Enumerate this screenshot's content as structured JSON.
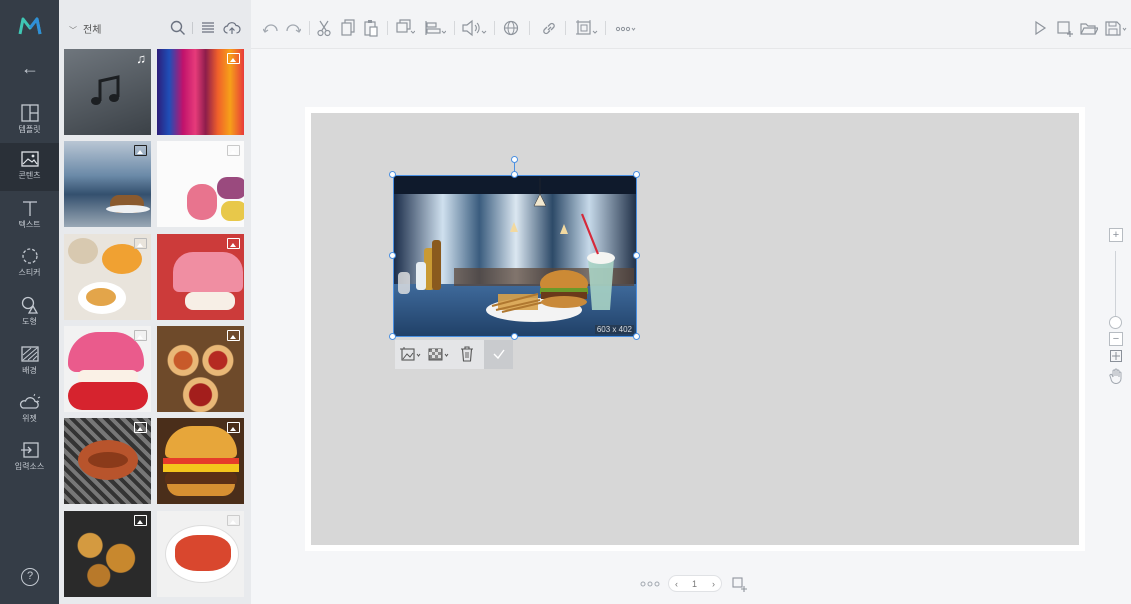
{
  "sidebar": {
    "items": [
      {
        "label": "템플릿",
        "icon": "template-icon"
      },
      {
        "label": "콘텐츠",
        "icon": "image-icon"
      },
      {
        "label": "텍스트",
        "icon": "text-icon"
      },
      {
        "label": "스티커",
        "icon": "sticker-icon"
      },
      {
        "label": "도형",
        "icon": "shape-icon"
      },
      {
        "label": "배경",
        "icon": "background-icon"
      },
      {
        "label": "위젯",
        "icon": "weather-widget-icon"
      },
      {
        "label": "입력소스",
        "icon": "input-source-icon"
      }
    ],
    "help": "?"
  },
  "panel": {
    "filter_label": "전체"
  },
  "canvas": {
    "size_label": "603 x 402"
  },
  "pager": {
    "current_page": "1"
  },
  "colors": {
    "rail": "#353d47",
    "selection": "#4a90e2",
    "logo_accent": "#3fc7b4"
  }
}
